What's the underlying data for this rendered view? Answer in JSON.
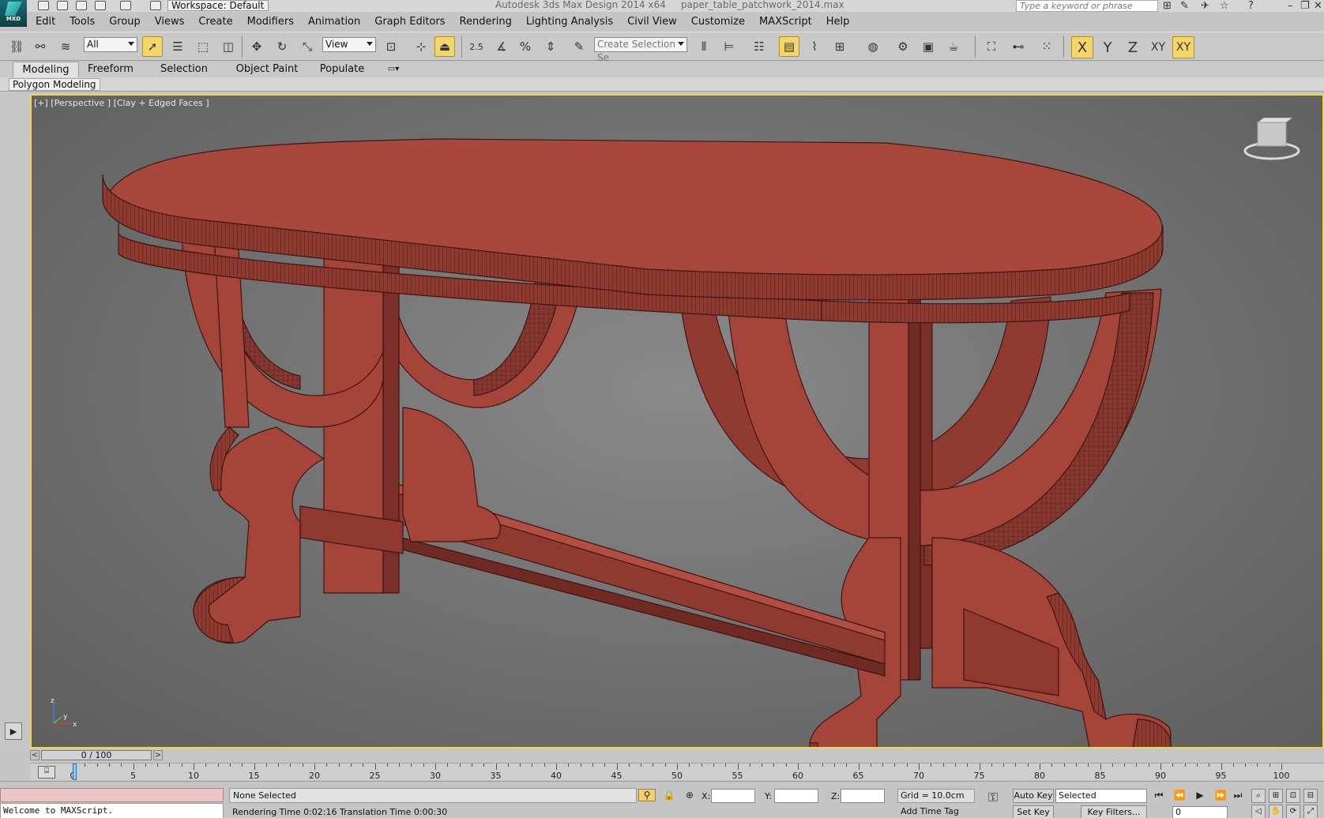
{
  "window": {
    "app_title": "Autodesk 3ds Max Design 2014 x64",
    "file_name": "paper_table_patchwork_2014.max",
    "logo_label": "MXD",
    "workspace_label": "Workspace: Default",
    "search_placeholder": "Type a keyword or phrase"
  },
  "menu": {
    "items": [
      "Edit",
      "Tools",
      "Group",
      "Views",
      "Create",
      "Modifiers",
      "Animation",
      "Graph Editors",
      "Rendering",
      "Lighting Analysis",
      "Civil View",
      "Customize",
      "MAXScript",
      "Help"
    ]
  },
  "toolbar": {
    "selection_filter": "All",
    "reference_coord": "View",
    "named_selection_placeholder": "Create Selection Se",
    "snap_label": "2.5",
    "axis_buttons": [
      "X",
      "Y",
      "Z",
      "XY",
      "XY"
    ]
  },
  "ribbon": {
    "tabs": [
      "Modeling",
      "Freeform",
      "Selection",
      "Object Paint",
      "Populate"
    ],
    "active_tab": "Modeling",
    "panel_label": "Polygon Modeling"
  },
  "viewport": {
    "label": "[+] [Perspective ] [Clay + Edged Faces ]",
    "model_color": "#a5453a",
    "border_color": "#f2d548",
    "axis_labels": [
      "z",
      "x",
      "y"
    ]
  },
  "timeline": {
    "frame_display": "0 / 100",
    "ruler_labels": [
      "0",
      "5",
      "10",
      "15",
      "20",
      "25",
      "30",
      "35",
      "40",
      "45",
      "50",
      "55",
      "60",
      "65",
      "70",
      "75",
      "80",
      "85",
      "90",
      "95",
      "100"
    ]
  },
  "status": {
    "maxscript_output": "Welcome to MAXScript.",
    "selection": "None Selected",
    "prompt": "Rendering Time  0:02:16    Translation Time  0:00:30",
    "x_label": "X:",
    "y_label": "Y:",
    "z_label": "Z:",
    "grid": "Grid = 10.0cm",
    "add_time_tag": "Add Time Tag",
    "auto_key": "Auto Key",
    "set_key": "Set Key",
    "selected_dropdown": "Selected",
    "key_filters": "Key Filters...",
    "current_frame": "0"
  }
}
